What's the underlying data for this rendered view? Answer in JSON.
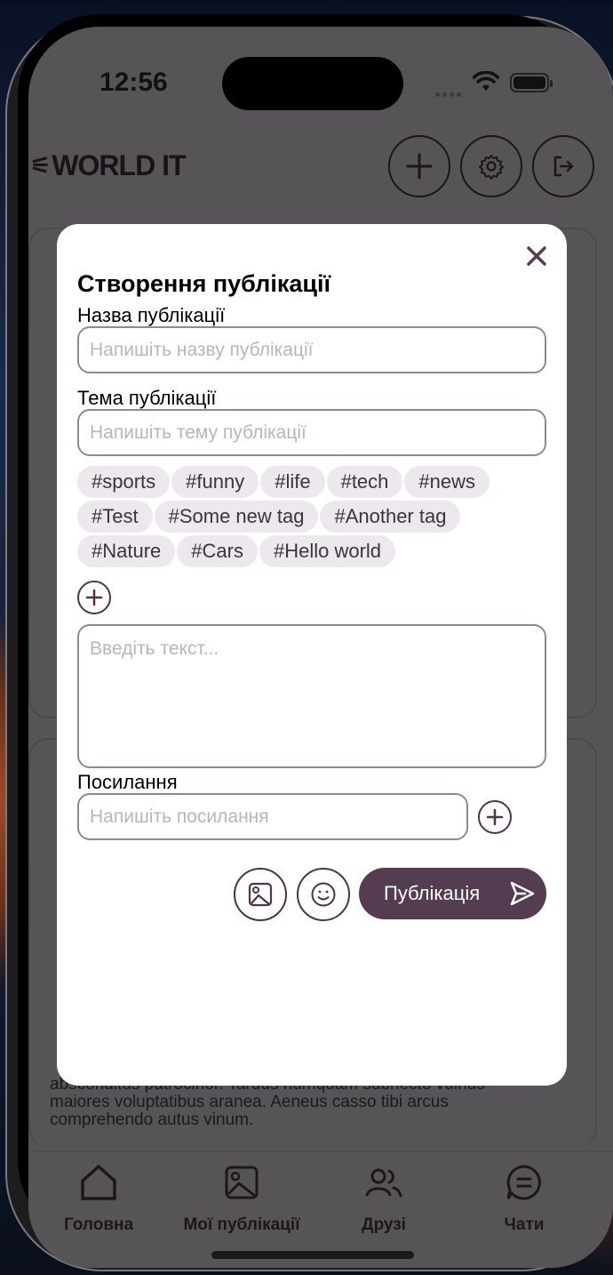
{
  "status": {
    "time": "12:56"
  },
  "header": {
    "logo_text": "WORLD IT",
    "buttons": [
      {
        "icon": "plus-icon"
      },
      {
        "icon": "gear-icon"
      },
      {
        "icon": "logout-icon"
      }
    ]
  },
  "background_post": {
    "lines": [
      "absconditus patrocinor. Tardus numquam subnecto vulnus",
      "maiores voluptatibus aranea. Aeneus casso tibi arcus",
      "comprehendo autus vinum."
    ]
  },
  "modal": {
    "title": "Створення публікації",
    "name_label": "Назва публікації",
    "name_placeholder": "Напишіть назву публікації",
    "topic_label": "Тема публікації",
    "topic_placeholder": "Напишіть тему публікації",
    "tags": [
      [
        "#sports",
        "#funny",
        "#life",
        "#tech",
        "#news"
      ],
      [
        "#Test",
        "#Some new tag",
        "#Another tag"
      ],
      [
        "#Nature",
        "#Cars",
        "#Hello world"
      ]
    ],
    "text_placeholder": "Введіть текст...",
    "link_label": "Посилання",
    "link_placeholder": "Напишіть посилання",
    "publish_label": "Публікація"
  },
  "bottom_nav": [
    {
      "label": "Головна",
      "icon": "home-icon"
    },
    {
      "label": "Мої публікації",
      "icon": "image-icon"
    },
    {
      "label": "Друзі",
      "icon": "friends-icon"
    },
    {
      "label": "Чати",
      "icon": "chat-icon"
    }
  ],
  "colors": {
    "accent": "#543d50",
    "overlay": "#575457",
    "tag_bg": "#ece8ee"
  }
}
